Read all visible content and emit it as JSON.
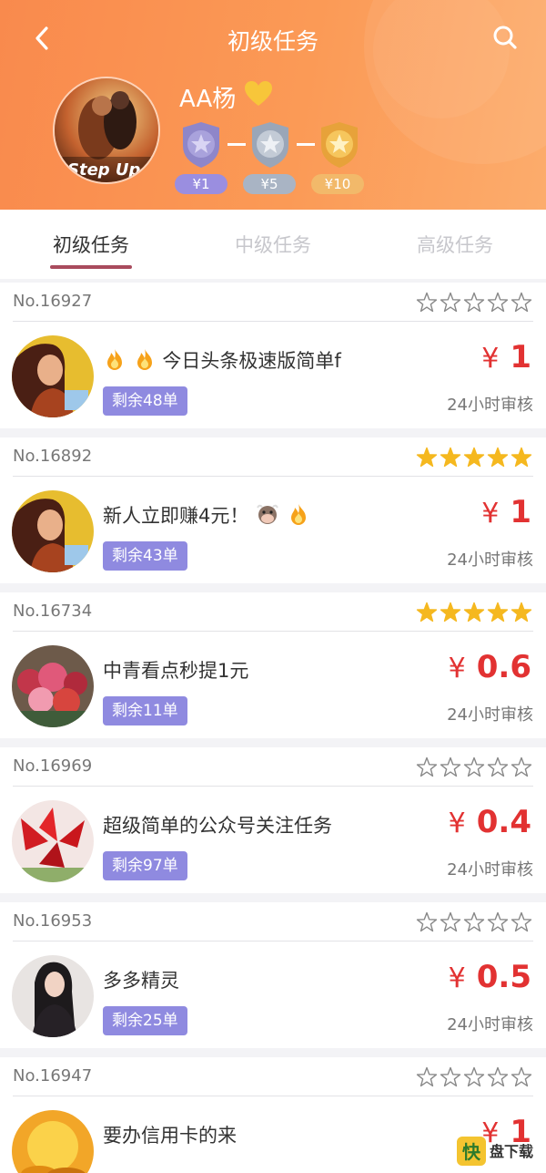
{
  "header": {
    "title": "初级任务",
    "username": "AA杨",
    "avatar_text": "Step Up",
    "levels": [
      {
        "label": "¥1",
        "pill_color": "#9a8ee0",
        "medal": "purple-star-medal"
      },
      {
        "label": "¥5",
        "pill_color": "#a9b4c4",
        "medal": "silver-star-medal"
      },
      {
        "label": "¥10",
        "pill_color": "#f2b96a",
        "medal": "gold-star-medal"
      }
    ]
  },
  "tabs": [
    {
      "label": "初级任务",
      "active": true
    },
    {
      "label": "中级任务",
      "active": false
    },
    {
      "label": "高级任务",
      "active": false
    }
  ],
  "tasks": [
    {
      "no": "No.16927",
      "stars": 0,
      "title": "今日头条极速版简单f",
      "title_icons": [
        "fire-icon",
        "fire-icon"
      ],
      "remaining": "剩余48单",
      "price_symbol": "¥",
      "price": "1",
      "review": "24小时审核",
      "thumb": "woman-illustration"
    },
    {
      "no": "No.16892",
      "stars": 5,
      "title": "新人立即赚4元！",
      "title_icons_after": [
        "cow-icon",
        "fire-icon"
      ],
      "remaining": "剩余43单",
      "price_symbol": "¥",
      "price": "1",
      "review": "24小时审核",
      "thumb": "woman-illustration"
    },
    {
      "no": "No.16734",
      "stars": 5,
      "title": "中青看点秒提1元",
      "remaining": "剩余11单",
      "price_symbol": "¥",
      "price": "0.6",
      "review": "24小时审核",
      "thumb": "flowers-photo"
    },
    {
      "no": "No.16969",
      "stars": 0,
      "title": "超级简单的公众号关注任务",
      "remaining": "剩余97单",
      "price_symbol": "¥",
      "price": "0.4",
      "review": "24小时审核",
      "thumb": "red-leaves-photo"
    },
    {
      "no": "No.16953",
      "stars": 0,
      "title": "多多精灵",
      "remaining": "剩余25单",
      "price_symbol": "¥",
      "price": "0.5",
      "review": "24小时审核",
      "thumb": "woman-portrait"
    },
    {
      "no": "No.16947",
      "stars": 0,
      "title": "要办信用卡的来",
      "remaining": "",
      "price_symbol": "¥",
      "price": "1",
      "review": "",
      "thumb": "gold-coins-photo"
    }
  ],
  "colors": {
    "header_orange": "#fb9a56",
    "price_red": "#e23232",
    "remaining_purple": "#8f8ae0",
    "star_gold": "#f5b81f",
    "tab_underline": "#a94b5d"
  },
  "watermark": {
    "char": "快",
    "text": "盘下载"
  }
}
